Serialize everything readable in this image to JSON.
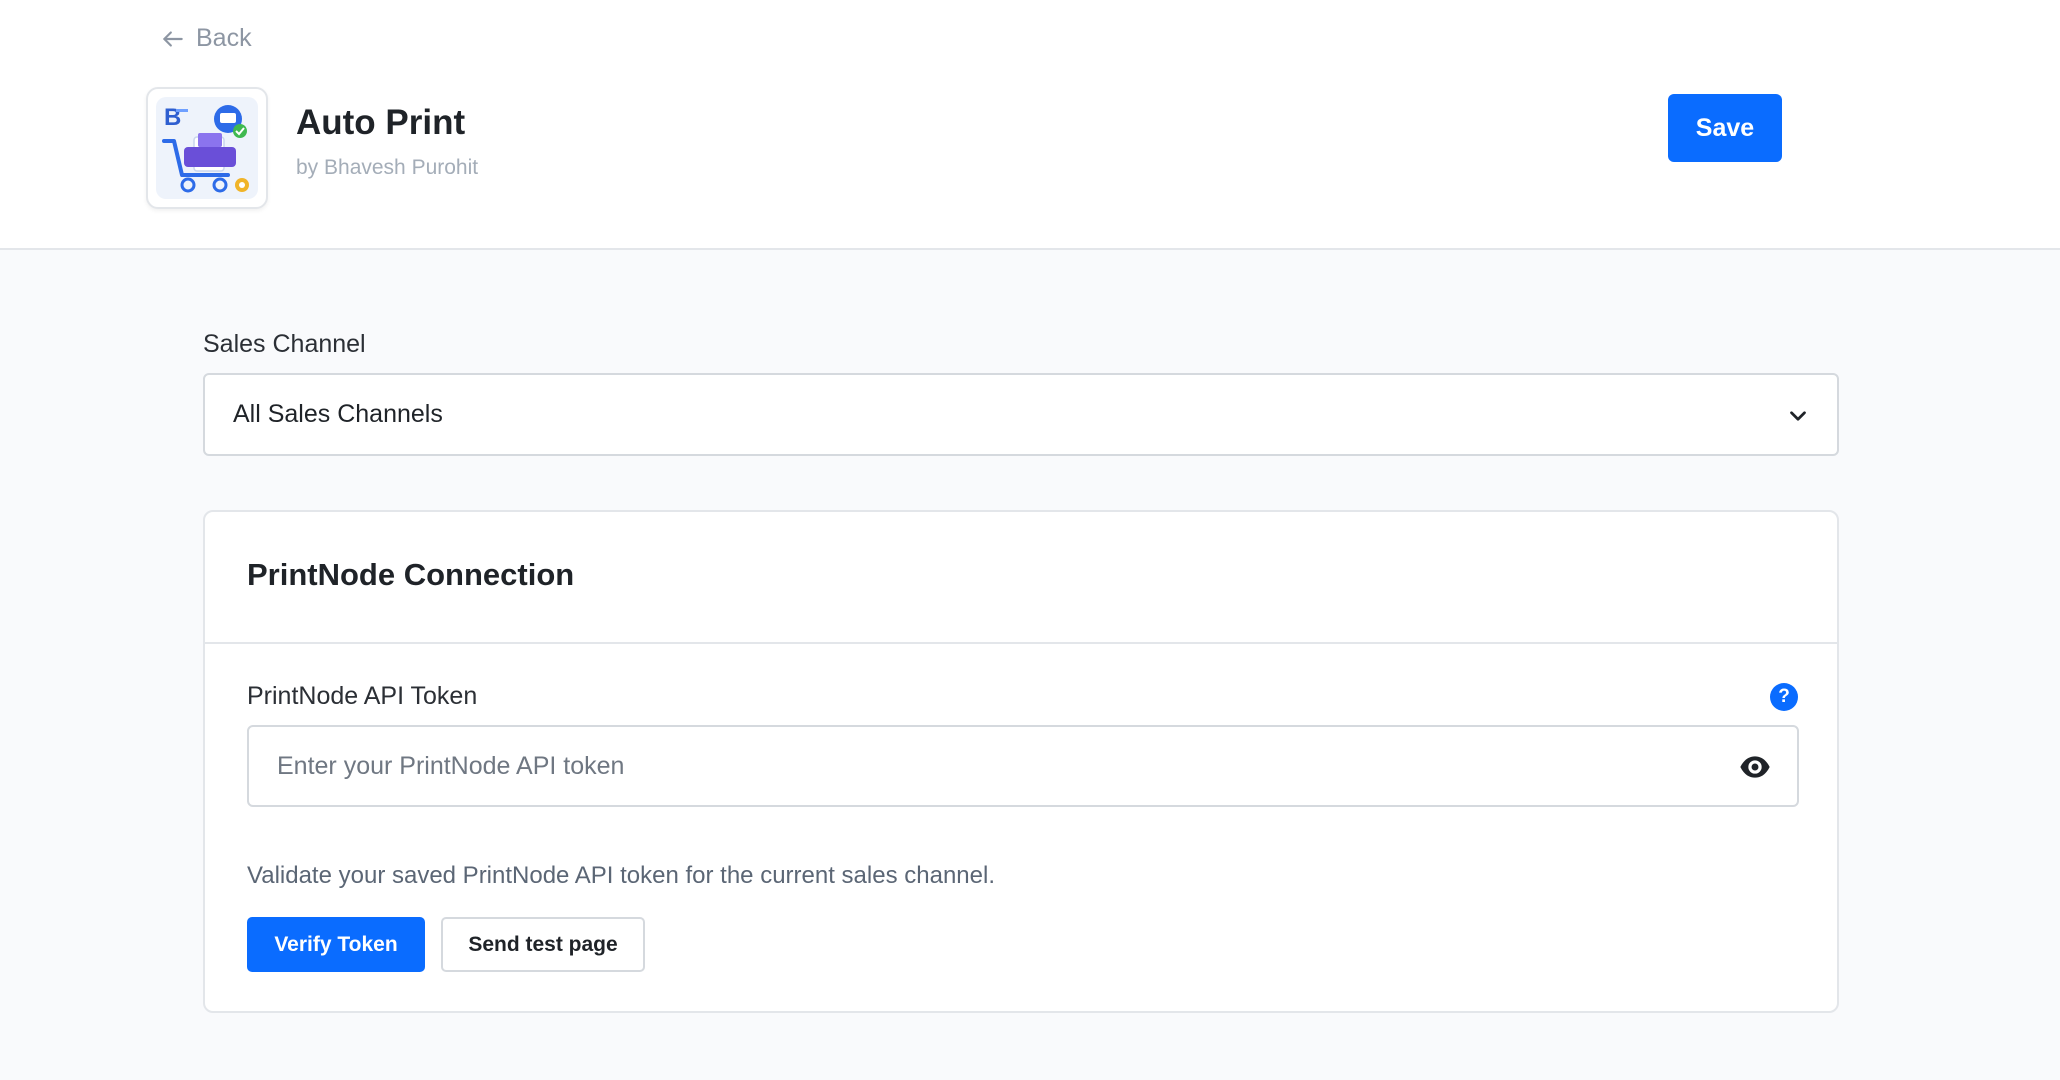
{
  "header": {
    "back_label": "Back",
    "app_title": "Auto Print",
    "app_author": "by Bhavesh Purohit",
    "save_label": "Save"
  },
  "sales_channel": {
    "label": "Sales Channel",
    "selected": "All Sales Channels"
  },
  "printnode_card": {
    "title": "PrintNode Connection",
    "token_label": "PrintNode API Token",
    "token_value": "",
    "token_placeholder": "Enter your PrintNode API token",
    "help_glyph": "?",
    "helper_text": "Validate your saved PrintNode API token for the current sales channel.",
    "verify_label": "Verify Token",
    "test_label": "Send test page"
  },
  "icons": {
    "back": "arrow-left-icon",
    "logo": "app-logo-icon",
    "dropdown": "chevron-down-icon",
    "help": "question-circle-icon",
    "visibility": "eye-icon"
  },
  "colors": {
    "primary": "#0a6cff",
    "muted_text": "#8d96a3",
    "border": "#d5d9de",
    "page_bg": "#f9fafc"
  }
}
